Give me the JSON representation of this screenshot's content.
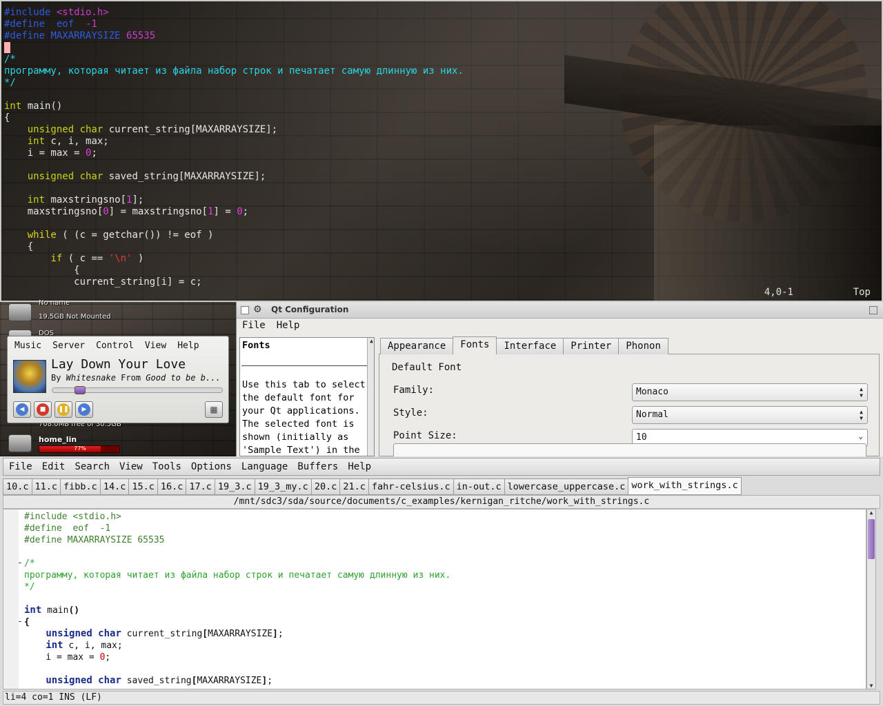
{
  "terminal": {
    "lines": [
      [
        {
          "c": "pp",
          "t": "#include "
        },
        {
          "c": "pp2",
          "t": "<stdio.h>"
        }
      ],
      [
        {
          "c": "pp",
          "t": "#define  eof  "
        },
        {
          "c": "pp2",
          "t": "-1"
        }
      ],
      [
        {
          "c": "pp",
          "t": "#define "
        },
        {
          "c": "pp",
          "t": "MAXARRAYSIZE "
        },
        {
          "c": "pp2",
          "t": "65535"
        }
      ],
      [
        {
          "c": "cursor",
          "t": ""
        }
      ],
      [
        {
          "c": "cm",
          "t": "/*"
        }
      ],
      [
        {
          "c": "cm",
          "t": "программу, которая читает из файла набор строк и печатает самую длинную из них."
        }
      ],
      [
        {
          "c": "cm",
          "t": "*/"
        }
      ],
      [],
      [
        {
          "c": "ty",
          "t": "int"
        },
        {
          "c": "tx",
          "t": " main()"
        }
      ],
      [
        {
          "c": "tx",
          "t": "{"
        }
      ],
      [
        {
          "c": "tx",
          "t": "    "
        },
        {
          "c": "ty",
          "t": "unsigned char"
        },
        {
          "c": "tx",
          "t": " current_string[MAXARRAYSIZE];"
        }
      ],
      [
        {
          "c": "tx",
          "t": "    "
        },
        {
          "c": "ty",
          "t": "int"
        },
        {
          "c": "tx",
          "t": " c, i, max;"
        }
      ],
      [
        {
          "c": "tx",
          "t": "    i = max = "
        },
        {
          "c": "nm",
          "t": "0"
        },
        {
          "c": "tx",
          "t": ";"
        }
      ],
      [],
      [
        {
          "c": "tx",
          "t": "    "
        },
        {
          "c": "ty",
          "t": "unsigned char"
        },
        {
          "c": "tx",
          "t": " saved_string[MAXARRAYSIZE];"
        }
      ],
      [],
      [
        {
          "c": "tx",
          "t": "    "
        },
        {
          "c": "ty",
          "t": "int"
        },
        {
          "c": "tx",
          "t": " maxstringsno["
        },
        {
          "c": "nm",
          "t": "1"
        },
        {
          "c": "tx",
          "t": "];"
        }
      ],
      [
        {
          "c": "tx",
          "t": "    maxstringsno["
        },
        {
          "c": "nm",
          "t": "0"
        },
        {
          "c": "tx",
          "t": "] = maxstringsno["
        },
        {
          "c": "nm",
          "t": "1"
        },
        {
          "c": "tx",
          "t": "] = "
        },
        {
          "c": "nm",
          "t": "0"
        },
        {
          "c": "tx",
          "t": ";"
        }
      ],
      [],
      [
        {
          "c": "tx",
          "t": "    "
        },
        {
          "c": "kw",
          "t": "while"
        },
        {
          "c": "tx",
          "t": " ( (c = getchar()) != eof )"
        }
      ],
      [
        {
          "c": "tx",
          "t": "    {"
        }
      ],
      [
        {
          "c": "tx",
          "t": "        "
        },
        {
          "c": "kw",
          "t": "if"
        },
        {
          "c": "tx",
          "t": " ( c == "
        },
        {
          "c": "str",
          "t": "'\\n'"
        },
        {
          "c": "tx",
          "t": " )"
        }
      ],
      [
        {
          "c": "tx",
          "t": "            {"
        }
      ],
      [
        {
          "c": "tx",
          "t": "            current_string[i] = c;"
        }
      ]
    ],
    "status_pos": "4,0-1",
    "status_top": "Top"
  },
  "desktop": {
    "disk1_name": "No name",
    "disk1_info": "19.5GB Not Mounted",
    "disk2_name": "DOS",
    "disk3_info": "708.0MB free of 30.5GB",
    "home_name": "home_lin",
    "home_usage_text": "77%",
    "home_usage": 0.77
  },
  "player": {
    "menu": [
      "Music",
      "Server",
      "Control",
      "View",
      "Help"
    ],
    "title": "Lay Down Your Love",
    "by": "By ",
    "artist": "Whitesnake",
    "from": " From ",
    "album": "Good to be b...",
    "progress": 0.14
  },
  "qtconf": {
    "title": "Qt Configuration",
    "menu": [
      "File",
      "Help"
    ],
    "help_heading": "Fonts",
    "help_body": "Use this tab to select the default font for your Qt applications. The selected font is shown (initially as 'Sample Text') in the",
    "tabs": [
      {
        "label": "Appearance",
        "active": false
      },
      {
        "label": "Fonts",
        "active": true
      },
      {
        "label": "Interface",
        "active": false
      },
      {
        "label": "Printer",
        "active": false
      },
      {
        "label": "Phonon",
        "active": false
      }
    ],
    "group_title": "Default Font",
    "family_label": "Family:",
    "family_value": "Monaco",
    "style_label": "Style:",
    "style_value": "Normal",
    "size_label": "Point Size:",
    "size_value": "10"
  },
  "editor": {
    "menu": [
      "File",
      "Edit",
      "Search",
      "View",
      "Tools",
      "Options",
      "Language",
      "Buffers",
      "Help"
    ],
    "tabs": [
      {
        "label": "10.c",
        "active": false
      },
      {
        "label": "11.c",
        "active": false
      },
      {
        "label": "fibb.c",
        "active": false
      },
      {
        "label": "14.c",
        "active": false
      },
      {
        "label": "15.c",
        "active": false
      },
      {
        "label": "16.c",
        "active": false
      },
      {
        "label": "17.c",
        "active": false
      },
      {
        "label": "19_3.c",
        "active": false
      },
      {
        "label": "19_3_my.c",
        "active": false
      },
      {
        "label": "20.c",
        "active": false
      },
      {
        "label": "21.c",
        "active": false
      },
      {
        "label": "fahr-celsius.c",
        "active": false
      },
      {
        "label": "in-out.c",
        "active": false
      },
      {
        "label": "lowercase_uppercase.c",
        "active": false
      },
      {
        "label": "work_with_strings.c",
        "active": true
      }
    ],
    "path": "/mnt/sdc3/sda/source/documents/c_examples/kernigan_ritche/work_with_strings.c",
    "lines": [
      [
        {
          "c": "e-pp",
          "t": "#include <stdio.h>"
        }
      ],
      [
        {
          "c": "e-pp",
          "t": "#define  eof  -1"
        }
      ],
      [
        {
          "c": "e-pp",
          "t": "#define MAXARRAYSIZE 65535"
        }
      ],
      [],
      [
        {
          "c": "e-cm",
          "t": "/*"
        }
      ],
      [
        {
          "c": "e-cm",
          "t": "программу, которая читает из файла набор строк и печатает самую длинную из них."
        }
      ],
      [
        {
          "c": "e-cm",
          "t": "*/"
        }
      ],
      [],
      [
        {
          "c": "e-kw",
          "t": "int"
        },
        {
          "c": "e-tx",
          "t": " main"
        },
        {
          "c": "e-br",
          "t": "()"
        }
      ],
      [
        {
          "c": "e-br",
          "t": "{"
        }
      ],
      [
        {
          "c": "e-tx",
          "t": "    "
        },
        {
          "c": "e-kw",
          "t": "unsigned char"
        },
        {
          "c": "e-tx",
          "t": " current_string"
        },
        {
          "c": "e-br",
          "t": "["
        },
        {
          "c": "e-tx",
          "t": "MAXARRAYSIZE"
        },
        {
          "c": "e-br",
          "t": "]"
        },
        {
          "c": "e-tx",
          "t": ";"
        }
      ],
      [
        {
          "c": "e-tx",
          "t": "    "
        },
        {
          "c": "e-kw",
          "t": "int"
        },
        {
          "c": "e-tx",
          "t": " c, i, max;"
        }
      ],
      [
        {
          "c": "e-tx",
          "t": "    i = max = "
        },
        {
          "c": "e-num",
          "t": "0"
        },
        {
          "c": "e-tx",
          "t": ";"
        }
      ],
      [],
      [
        {
          "c": "e-tx",
          "t": "    "
        },
        {
          "c": "e-kw",
          "t": "unsigned char"
        },
        {
          "c": "e-tx",
          "t": " saved_string"
        },
        {
          "c": "e-br",
          "t": "["
        },
        {
          "c": "e-tx",
          "t": "MAXARRAYSIZE"
        },
        {
          "c": "e-br",
          "t": "]"
        },
        {
          "c": "e-tx",
          "t": ";"
        }
      ]
    ],
    "fold_marks": [
      {
        "line": 4,
        "mark": "-"
      },
      {
        "line": 9,
        "mark": "-"
      }
    ],
    "status": "li=4 co=1 INS (LF)"
  }
}
